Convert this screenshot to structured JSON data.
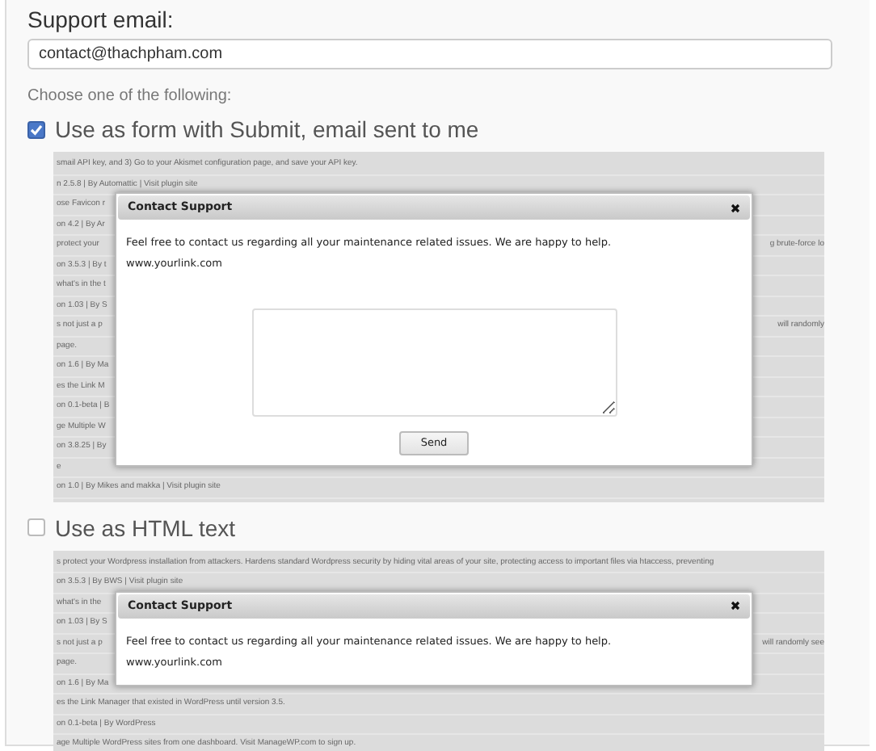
{
  "support_email": {
    "label": "Support email:",
    "value": "contact@thachpham.com"
  },
  "choose_label": "Choose one of the following:",
  "options": [
    {
      "label": "Use as form with Submit, email sent to me",
      "checked": true,
      "preview": {
        "rows": [
          {
            "left": "smail API key, and 3) Go to your Akismet configuration page, and save your API key."
          },
          {
            "left": "n 2.5.8 | By Automattic | Visit plugin site"
          },
          {
            "left": "ose Favicon r"
          },
          {
            "left": "on 4.2 | By Ar"
          },
          {
            "left": "protect your",
            "right": "g brute-force lo"
          },
          {
            "left": "on 3.5.3 | By t"
          },
          {
            "left": "what's in the t"
          },
          {
            "left": "on 1.03 | By S"
          },
          {
            "left": "s not just a p",
            "right": "will randomly"
          },
          {
            "left": "page."
          },
          {
            "left": "on 1.6 | By Ma"
          },
          {
            "left": "es the Link M"
          },
          {
            "left": "on 0.1-beta | B"
          },
          {
            "left": "ge Multiple W"
          },
          {
            "left": "on 3.8.25 | By"
          },
          {
            "left": "e"
          },
          {
            "left": "on 1.0 | By Mikes and makka | Visit plugin site"
          }
        ],
        "modal": {
          "title": "Contact Support",
          "message": "Feel free to contact us regarding all your maintenance related issues. We are happy to help.",
          "link": "www.yourlink.com",
          "has_form": true,
          "button": "Send"
        }
      }
    },
    {
      "label": "Use as HTML text",
      "checked": false,
      "preview": {
        "rows": [
          {
            "left": "s protect your Wordpress installation from attackers. Hardens standard Wordpress security by hiding vital areas of your site, protecting access to important files via htaccess, preventing"
          },
          {
            "left": "on 3.5.3 | By BWS | Visit plugin site"
          },
          {
            "left": "what's in the"
          },
          {
            "left": "on 1.03 | By S"
          },
          {
            "left": "s not just a p",
            "right": "will randomly see"
          },
          {
            "left": "page."
          },
          {
            "left": "on 1.6 | By Ma"
          },
          {
            "left": "es the Link Manager that existed in WordPress until version 3.5."
          },
          {
            "left": "on 0.1-beta | By WordPress"
          },
          {
            "left": "age Multiple WordPress sites from one dashboard. Visit ManageWP.com to sign up."
          }
        ],
        "modal": {
          "title": "Contact Support",
          "message": "Feel free to contact us regarding all your maintenance related issues. We are happy to help.",
          "link": "www.yourlink.com",
          "has_form": false
        }
      }
    }
  ]
}
